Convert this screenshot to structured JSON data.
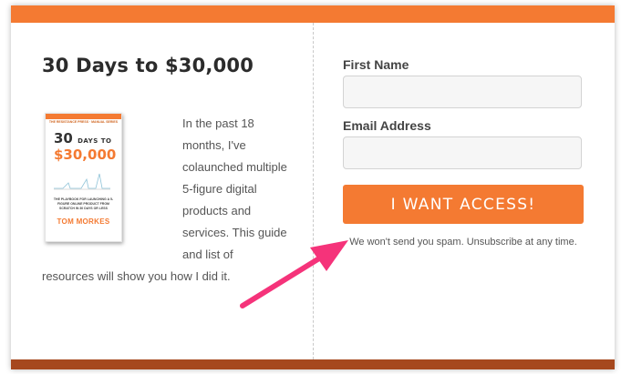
{
  "offer": {
    "headline": "30 Days to $30,000",
    "body": "In the past 18 months, I've colaunched multiple 5-figure digital products and services. This guide and list of resources will show you how I did it."
  },
  "book_cover": {
    "series": "THE RESISTANCE PRESS · MANUAL SERIES",
    "title_number": "30",
    "title_days": "DAYS TO",
    "title_amount": "$30,000",
    "subtitle": "THE PLAYBOOK FOR LAUNCHING A 5-FIGURE ONLINE PRODUCT FROM SCRATCH IN 30 DAYS OR LESS",
    "author": "TOM MORKES"
  },
  "form": {
    "first_name_label": "First Name",
    "first_name_value": "",
    "email_label": "Email Address",
    "email_value": "",
    "submit_label": "I WANT ACCESS!",
    "disclaimer": "We won't send you spam. Unsubscribe at any time."
  },
  "colors": {
    "accent": "#f47a32",
    "footer_bar": "#a6481e",
    "annotation_arrow": "#f5337a"
  },
  "icons": {
    "annotation": "arrow-annotation-icon"
  }
}
